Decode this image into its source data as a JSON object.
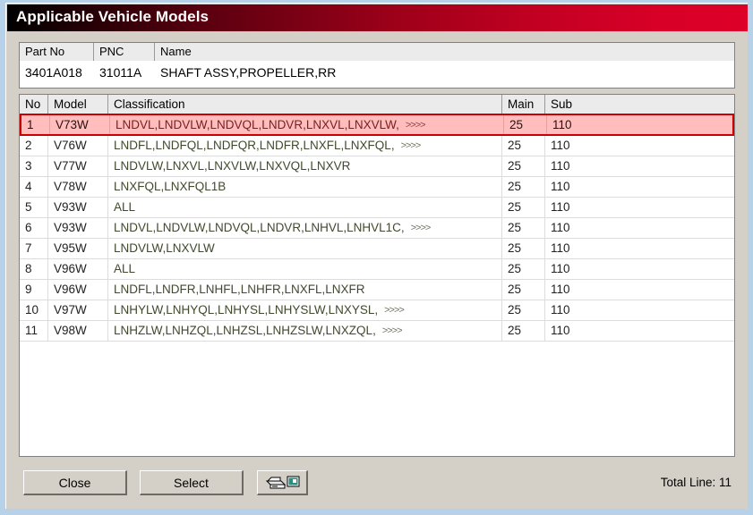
{
  "window": {
    "title": "Applicable Vehicle Models",
    "titlebar_gradient_from": "#000000",
    "titlebar_gradient_to": "#dd0029",
    "face_color": "#d4d0c8",
    "outer_border_color": "#b7d2e8"
  },
  "part_info": {
    "headers": [
      "Part No",
      "PNC",
      "Name"
    ],
    "part_no": "3401A018",
    "pnc": "31011A",
    "name": "SHAFT ASSY,PROPELLER,RR"
  },
  "grid": {
    "headers": [
      "No",
      "Model",
      "Classification",
      "Main",
      "Sub"
    ],
    "selected_row_index": 0,
    "selected_bg": "#ffbdbd",
    "selected_border": "#cc0000",
    "classification_color": "#414a2e",
    "more_marker": ">>>>",
    "rows": [
      {
        "no": "1",
        "model": "V73W",
        "classification": "LNDVL,LNDVLW,LNDVQL,LNDVR,LNXVL,LNXVLW,",
        "more": true,
        "main": "25",
        "sub": "110"
      },
      {
        "no": "2",
        "model": "V76W",
        "classification": "LNDFL,LNDFQL,LNDFQR,LNDFR,LNXFL,LNXFQL,",
        "more": true,
        "main": "25",
        "sub": "110"
      },
      {
        "no": "3",
        "model": "V77W",
        "classification": "LNDVLW,LNXVL,LNXVLW,LNXVQL,LNXVR",
        "more": false,
        "main": "25",
        "sub": "110"
      },
      {
        "no": "4",
        "model": "V78W",
        "classification": "LNXFQL,LNXFQL1B",
        "more": false,
        "main": "25",
        "sub": "110"
      },
      {
        "no": "5",
        "model": "V93W",
        "classification": "ALL",
        "more": false,
        "main": "25",
        "sub": "110"
      },
      {
        "no": "6",
        "model": "V93W",
        "classification": "LNDVL,LNDVLW,LNDVQL,LNDVR,LNHVL,LNHVL1C,",
        "more": true,
        "main": "25",
        "sub": "110"
      },
      {
        "no": "7",
        "model": "V95W",
        "classification": "LNDVLW,LNXVLW",
        "more": false,
        "main": "25",
        "sub": "110"
      },
      {
        "no": "8",
        "model": "V96W",
        "classification": "ALL",
        "more": false,
        "main": "25",
        "sub": "110"
      },
      {
        "no": "9",
        "model": "V96W",
        "classification": "LNDFL,LNDFR,LNHFL,LNHFR,LNXFL,LNXFR",
        "more": false,
        "main": "25",
        "sub": "110"
      },
      {
        "no": "10",
        "model": "V97W",
        "classification": "LNHYLW,LNHYQL,LNHYSL,LNHYSLW,LNXYSL,",
        "more": true,
        "main": "25",
        "sub": "110"
      },
      {
        "no": "11",
        "model": "V98W",
        "classification": "LNHZLW,LNHZQL,LNHZSL,LNHZSLW,LNXZQL,",
        "more": true,
        "main": "25",
        "sub": "110"
      }
    ]
  },
  "footer": {
    "close_label": "Close",
    "select_label": "Select",
    "print_icon": "printer-icon",
    "total_line_label": "Total Line: 11"
  }
}
